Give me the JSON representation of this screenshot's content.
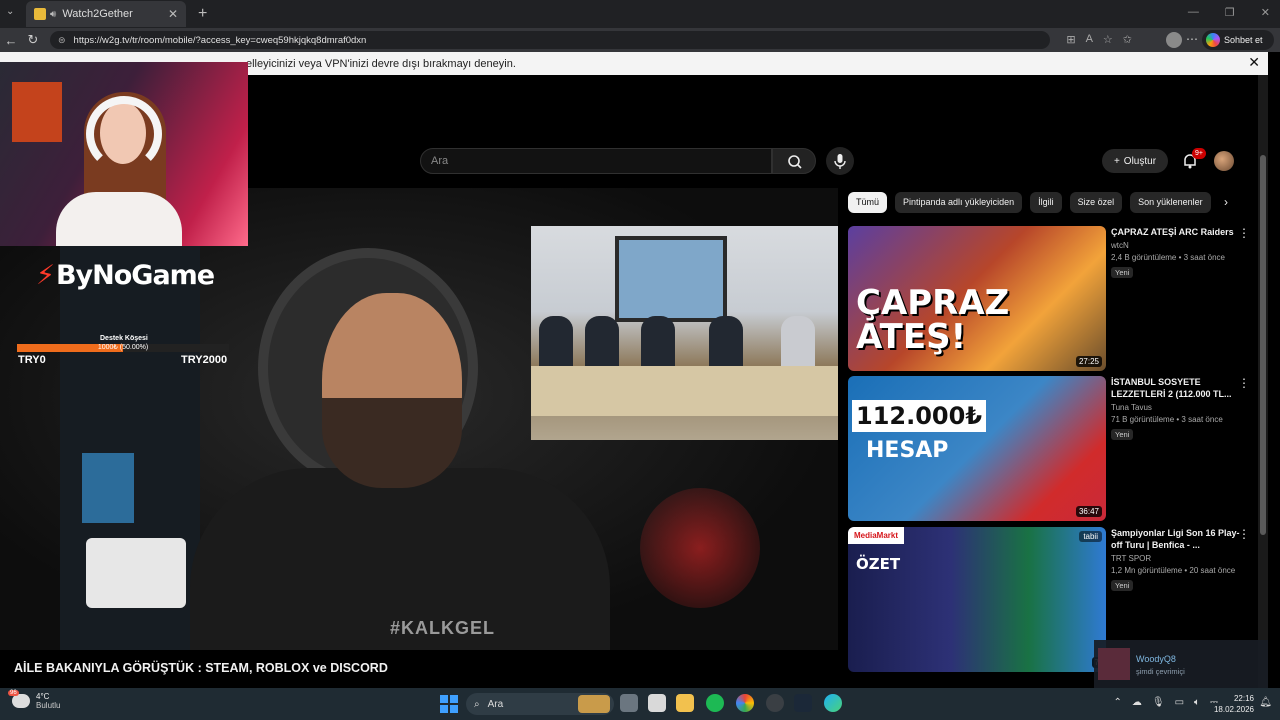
{
  "browser": {
    "tab_title": "Watch2Gether",
    "tab_close": "✕",
    "new_tab": "+",
    "url": "https://w2g.tv/tr/room/mobile/?access_key=cweq59hkjqkq8dmraf0dxn",
    "copilot_label": "Sohbet et"
  },
  "notice": {
    "text": "elleyicinizi veya VPN'inizi devre dışı bırakmayı deneyin.",
    "close": "✕"
  },
  "youtube": {
    "search_placeholder": "Ara",
    "create_label": "Oluştur",
    "notif_badge": "9+",
    "chips": [
      "Tümü",
      "Pintipanda adlı yükleyiciden",
      "İlgili",
      "Size özel",
      "Son yüklenenler"
    ],
    "video_title": "AİLE BAKANIYLA GÖRÜŞTÜK : STEAM, ROBLOX ve DISCORD",
    "video_shirt_text": "#KALKGEL",
    "recommendations": [
      {
        "title": "ÇAPRAZ ATEŞİ ARC Raiders",
        "channel": "wtcN",
        "meta": "2,4 B görüntüleme • 3 saat önce",
        "badge": "Yeni",
        "duration": "27:25",
        "thumb_text": "ÇAPRAZ ATEŞ!"
      },
      {
        "title": "İSTANBUL SOSYETE LEZZETLERİ 2 (112.000 TL...",
        "channel": "Tuna Tavus",
        "meta": "71 B görüntüleme • 3 saat önce",
        "badge": "Yeni",
        "duration": "36:47",
        "thumb_text": "112.000₺",
        "thumb_text2": "HESAP"
      },
      {
        "title": "Şampiyonlar Ligi Son 16 Play-off Turu | Benfica - ...",
        "channel": "TRT SPOR",
        "meta": "1,2 Mn görüntüleme • 20 saat önce",
        "badge": "Yeni",
        "duration": "7",
        "thumb_text": "ÖZET",
        "thumb_brand": "MediaMarkt",
        "thumb_tag": "tabii"
      }
    ]
  },
  "overlay": {
    "brand": "ByNoGame",
    "destek_label": "Destek Köşesi",
    "destek_progress_text": "1000₺ (50.00%)",
    "destek_progress": 0.5,
    "min_label": "TRY0",
    "max_label": "TRY2000"
  },
  "friend": {
    "name": "WoodyQ8",
    "status": "şimdi çevrimiçi"
  },
  "taskbar": {
    "weather_temp": "4°C",
    "weather_desc": "Bulutlu",
    "weather_badge": "96",
    "search_label": "Ara",
    "time": "22:16",
    "date": "18.02.2026"
  },
  "colors": {
    "progress_fill": "#ef6c1c",
    "yt_bg": "#000000",
    "notif_red": "#cc0000"
  }
}
